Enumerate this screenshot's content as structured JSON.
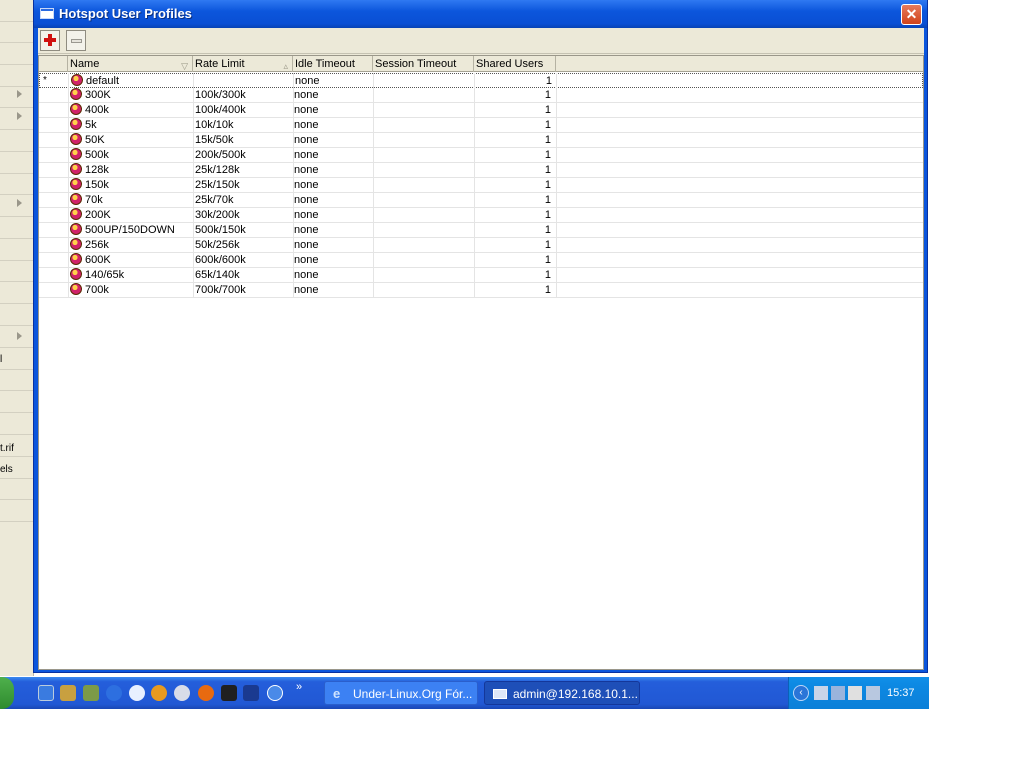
{
  "window": {
    "title": "Hotspot User Profiles"
  },
  "toolbar": {
    "add_icon": "plus-icon",
    "remove_icon": "minus-icon"
  },
  "table": {
    "columns": [
      "Name",
      "Rate Limit",
      "Idle Timeout",
      "Session Timeout",
      "Shared Users"
    ],
    "rows": [
      {
        "marker": "*",
        "name": "default",
        "rate": "",
        "idle": "none",
        "session": "",
        "shared": "1"
      },
      {
        "marker": "",
        "name": "300K",
        "rate": "100k/300k",
        "idle": "none",
        "session": "",
        "shared": "1"
      },
      {
        "marker": "",
        "name": "400k",
        "rate": "100k/400k",
        "idle": "none",
        "session": "",
        "shared": "1"
      },
      {
        "marker": "",
        "name": "5k",
        "rate": "10k/10k",
        "idle": "none",
        "session": "",
        "shared": "1"
      },
      {
        "marker": "",
        "name": "50K",
        "rate": "15k/50k",
        "idle": "none",
        "session": "",
        "shared": "1"
      },
      {
        "marker": "",
        "name": "500k",
        "rate": "200k/500k",
        "idle": "none",
        "session": "",
        "shared": "1"
      },
      {
        "marker": "",
        "name": "128k",
        "rate": "25k/128k",
        "idle": "none",
        "session": "",
        "shared": "1"
      },
      {
        "marker": "",
        "name": "150k",
        "rate": "25k/150k",
        "idle": "none",
        "session": "",
        "shared": "1"
      },
      {
        "marker": "",
        "name": "70k",
        "rate": "25k/70k",
        "idle": "none",
        "session": "",
        "shared": "1"
      },
      {
        "marker": "",
        "name": "200K",
        "rate": "30k/200k",
        "idle": "none",
        "session": "",
        "shared": "1"
      },
      {
        "marker": "",
        "name": "500UP/150DOWN",
        "rate": "500k/150k",
        "idle": "none",
        "session": "",
        "shared": "1"
      },
      {
        "marker": "",
        "name": "256k",
        "rate": "50k/256k",
        "idle": "none",
        "session": "",
        "shared": "1"
      },
      {
        "marker": "",
        "name": "600K",
        "rate": "600k/600k",
        "idle": "none",
        "session": "",
        "shared": "1"
      },
      {
        "marker": "",
        "name": "140/65k",
        "rate": "65k/140k",
        "idle": "none",
        "session": "",
        "shared": "1"
      },
      {
        "marker": "",
        "name": "700k",
        "rate": "700k/700k",
        "idle": "none",
        "session": "",
        "shared": "1"
      }
    ]
  },
  "background_sidebar": {
    "texts": [
      "l",
      "t.rif",
      "els"
    ]
  },
  "taskbar": {
    "tasks": [
      {
        "label": "Under-Linux.Org Fór...",
        "icon": "ie-icon"
      },
      {
        "label": "admin@192.168.10.1...",
        "icon": "winbox-icon"
      }
    ],
    "overflow": "»",
    "tray_arrow": "‹",
    "clock": "15:37"
  },
  "colors": {
    "titlebar": "#0a55dc",
    "taskbar": "#245edb",
    "close_button": "#d1431a",
    "add_icon": "#d01010"
  }
}
